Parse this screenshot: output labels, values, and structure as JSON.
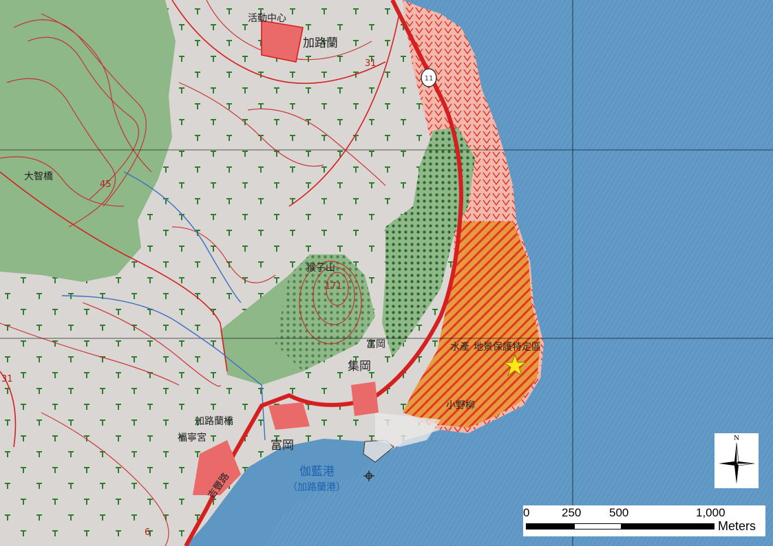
{
  "map": {
    "place_labels": {
      "activity_center": "活動中心",
      "jialulan": "加路蘭",
      "dazhi_bridge": "大智橋",
      "houzishan": "猴子山",
      "fugang_upper": "富岡",
      "jigang": "集岡",
      "jialulan_bridge": "加路蘭橋",
      "funing_temple": "福寧宮",
      "fugang": "富岡",
      "harbor_name": "伽藍港",
      "harbor_alias": "（加路蘭港）",
      "road_label": "吉豐路",
      "geology_label": "小野柳",
      "zone_label": "地景保護特定區",
      "zone_label_note": "水產"
    },
    "elevation_labels": {
      "e31": "31",
      "e45": "45",
      "e171": "171",
      "e31_left": "31",
      "e6": "6"
    },
    "highway_shield": "11",
    "colors": {
      "sea": "#5f97c4",
      "land": "#d9d6d3",
      "forest": "#8fb889",
      "road": "#d42020",
      "hatch": "#e0411f",
      "star": "#ffe81a"
    },
    "scale_bar": {
      "ticks": [
        "0",
        "250",
        "500",
        "1,000"
      ],
      "units": "Meters"
    },
    "north_arrow": {
      "letter": "N"
    },
    "marker": {
      "icon": "star-icon"
    }
  }
}
